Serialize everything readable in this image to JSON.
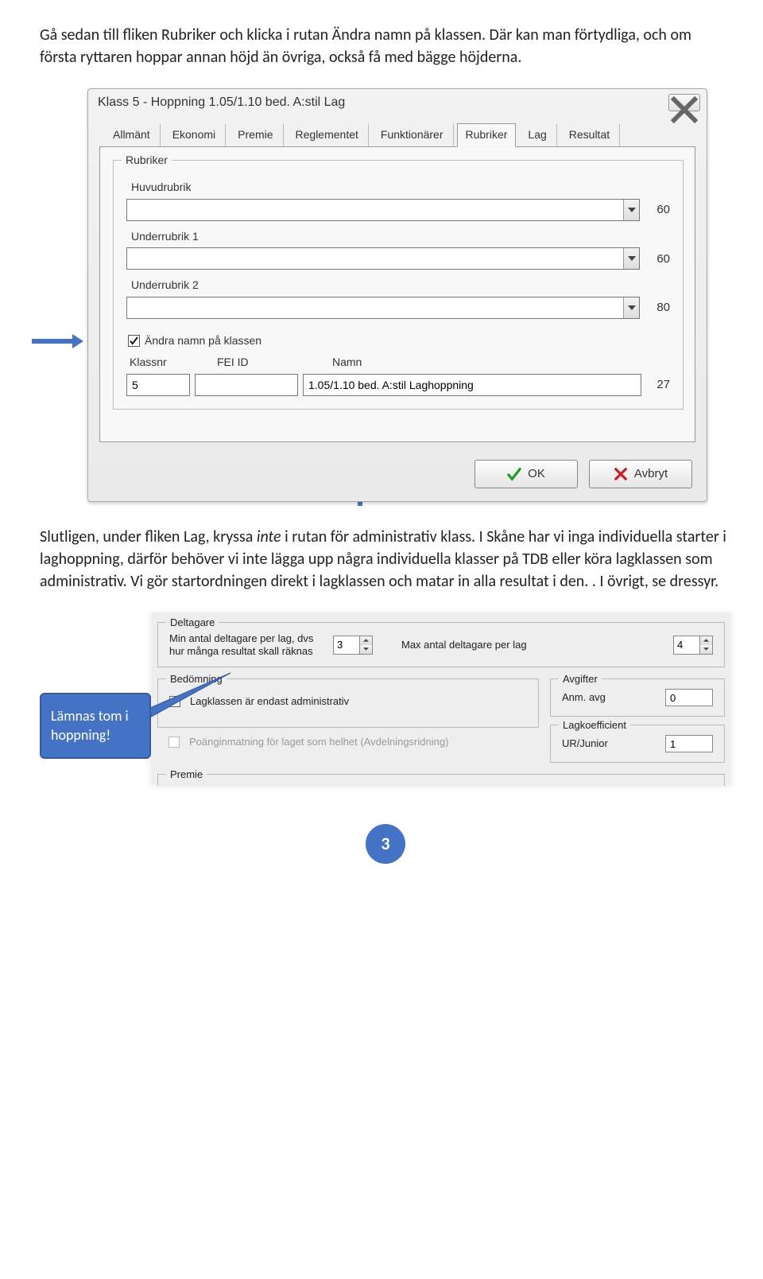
{
  "intro_paragraph": "Gå sedan till fliken Rubriker och klicka i rutan Ändra namn på klassen. Där kan man förtydliga, och om första ryttaren hoppar annan höjd än övriga, också få med bägge höjderna.",
  "dialog": {
    "title": "Klass 5 - Hoppning 1.05/1.10 bed. A:stil Lag",
    "tabs": [
      "Allmänt",
      "Ekonomi",
      "Premie",
      "Reglementet",
      "Funktionärer",
      "Rubriker",
      "Lag",
      "Resultat"
    ],
    "active_tab": "Rubriker",
    "group_title": "Rubriker",
    "huvudrubrik_label": "Huvudrubrik",
    "huvudrubrik_count": "60",
    "under1_label": "Underrubrik 1",
    "under1_count": "60",
    "under2_label": "Underrubrik 2",
    "under2_count": "80",
    "checkbox_label": "Ändra namn på klassen",
    "col_klassnr": "Klassnr",
    "col_fei": "FEI ID",
    "col_namn": "Namn",
    "klassnr_value": "5",
    "namn_value": "1.05/1.10 bed. A:stil Laghoppning",
    "namn_count": "27",
    "ok_label": "OK",
    "cancel_label": "Avbryt"
  },
  "middle_paragraph_a": "Slutligen, under fliken Lag, kryssa ",
  "middle_paragraph_italic": "inte",
  "middle_paragraph_b": " i rutan för administrativ klass. I Skåne har vi inga individuella starter i laghoppning, därför behöver vi inte lägga upp några individuella klasser på TDB eller köra lagklassen som administrativ. Vi gör startordningen direkt i lagklassen och matar in alla resultat i den. . I övrigt, se dressyr.",
  "lag": {
    "deltagare_legend": "Deltagare",
    "min_label_a": "Min antal deltagare per lag, dvs",
    "min_label_b": "hur många resultat skall räknas",
    "min_value": "3",
    "max_label": "Max antal deltagare per lag",
    "max_value": "4",
    "bedomning_legend": "Bedömning",
    "bedomning_chk": "Lagklassen är endast administrativ",
    "poang_chk": "Poänginmatning för laget som helhet (Avdelningsridning)",
    "avgifter_legend": "Avgifter",
    "avgifter_label": "Anm. avg",
    "avgifter_value": "0",
    "lagkoef_legend": "Lagkoefficient",
    "lagkoef_label": "UR/Junior",
    "lagkoef_value": "1",
    "premie_legend": "Premie"
  },
  "callout_text": "Lämnas tom i hoppning!",
  "page_number": "3"
}
